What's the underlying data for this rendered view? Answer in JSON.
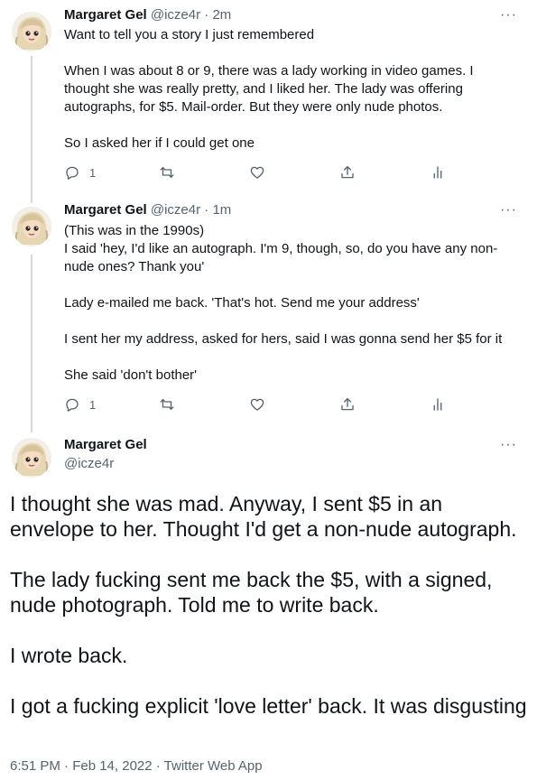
{
  "author": {
    "name": "Margaret Gel",
    "handle": "@icze4r"
  },
  "tweets": [
    {
      "time": "2m",
      "paragraphs": [
        "Want to tell you a story I just remembered",
        "When I was about 8 or 9, there was a lady working in video games. I thought she was really pretty, and I liked her. The lady was offering autographs, for $5. Mail-order. But they were only nude photos.",
        "So I asked her if I could get one"
      ],
      "reply_count": "1"
    },
    {
      "time": "1m",
      "paragraphs": [
        "(This was in the 1990s)\nI said 'hey, I'd like an autograph. I'm 9, though, so, do you have any non-nude ones? Thank you'",
        "Lady e-mailed me back. 'That's hot. Send me your address'",
        "I sent her my address, asked for hers, said I was gonna send her $5 for it",
        "She said 'don't bother'"
      ],
      "reply_count": "1"
    }
  ],
  "main_tweet": {
    "paragraphs": [
      "I thought she was mad. Anyway, I sent $5 in an envelope to her. Thought I'd get a non-nude autograph.",
      "The lady fucking sent me back the $5, with a signed, nude photograph. Told me to write back.",
      "I wrote back.",
      "I got a fucking explicit 'love letter' back. It was disgusting"
    ],
    "timestamp": "6:51 PM · Feb 14, 2022 · Twitter Web App"
  },
  "ui": {
    "dot_sep": " · ",
    "more_glyph": "···",
    "icons": [
      "reply-icon",
      "retweet-icon",
      "like-icon",
      "share-icon",
      "analytics-icon",
      "more-icon"
    ]
  }
}
